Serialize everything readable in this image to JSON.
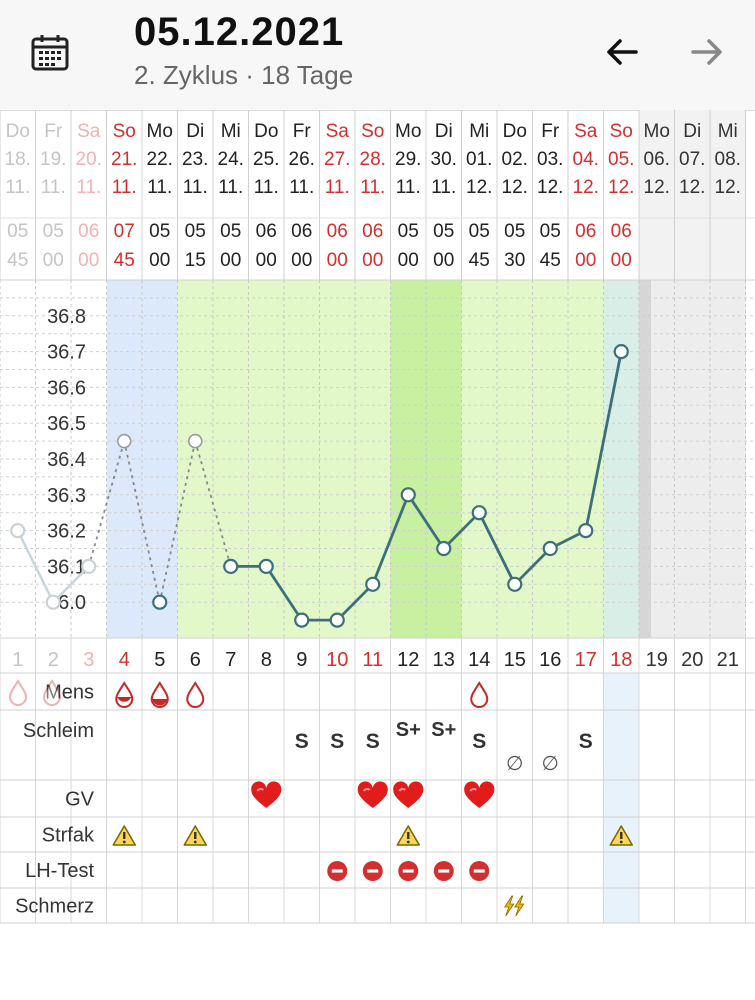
{
  "header": {
    "title": "05.12.2021",
    "subtitle": "2. Zyklus · 18 Tage",
    "icons": {
      "calendar": "calendar-icon",
      "prev": "arrow-left-icon",
      "next": "arrow-right-icon"
    }
  },
  "days": [
    {
      "wd": "Do",
      "d": "18.",
      "m": "11.",
      "h": "05",
      "mi": "45",
      "cd": "1"
    },
    {
      "wd": "Fr",
      "d": "19.",
      "m": "11.",
      "h": "05",
      "mi": "00",
      "cd": "2"
    },
    {
      "wd": "Sa",
      "d": "20.",
      "m": "11.",
      "h": "06",
      "mi": "00",
      "cd": "3"
    },
    {
      "wd": "So",
      "d": "21.",
      "m": "11.",
      "h": "07",
      "mi": "45",
      "cd": "4"
    },
    {
      "wd": "Mo",
      "d": "22.",
      "m": "11.",
      "h": "05",
      "mi": "00",
      "cd": "5"
    },
    {
      "wd": "Di",
      "d": "23.",
      "m": "11.",
      "h": "05",
      "mi": "15",
      "cd": "6"
    },
    {
      "wd": "Mi",
      "d": "24.",
      "m": "11.",
      "h": "05",
      "mi": "00",
      "cd": "7"
    },
    {
      "wd": "Do",
      "d": "25.",
      "m": "11.",
      "h": "06",
      "mi": "00",
      "cd": "8"
    },
    {
      "wd": "Fr",
      "d": "26.",
      "m": "11.",
      "h": "06",
      "mi": "00",
      "cd": "9"
    },
    {
      "wd": "Sa",
      "d": "27.",
      "m": "11.",
      "h": "06",
      "mi": "00",
      "cd": "10"
    },
    {
      "wd": "So",
      "d": "28.",
      "m": "11.",
      "h": "06",
      "mi": "00",
      "cd": "11"
    },
    {
      "wd": "Mo",
      "d": "29.",
      "m": "11.",
      "h": "05",
      "mi": "00",
      "cd": "12"
    },
    {
      "wd": "Di",
      "d": "30.",
      "m": "11.",
      "h": "05",
      "mi": "00",
      "cd": "13"
    },
    {
      "wd": "Mi",
      "d": "01.",
      "m": "12.",
      "h": "05",
      "mi": "45",
      "cd": "14"
    },
    {
      "wd": "Do",
      "d": "02.",
      "m": "12.",
      "h": "05",
      "mi": "30",
      "cd": "15"
    },
    {
      "wd": "Fr",
      "d": "03.",
      "m": "12.",
      "h": "05",
      "mi": "45",
      "cd": "16"
    },
    {
      "wd": "Sa",
      "d": "04.",
      "m": "12.",
      "h": "06",
      "mi": "00",
      "cd": "17"
    },
    {
      "wd": "So",
      "d": "05.",
      "m": "12.",
      "h": "06",
      "mi": "00",
      "cd": "18"
    },
    {
      "wd": "Mo",
      "d": "06.",
      "m": "12.",
      "h": "",
      "mi": "",
      "cd": "19"
    },
    {
      "wd": "Di",
      "d": "07.",
      "m": "12.",
      "h": "",
      "mi": "",
      "cd": "20"
    },
    {
      "wd": "Mi",
      "d": "08.",
      "m": "12.",
      "h": "",
      "mi": "",
      "cd": "21"
    }
  ],
  "chart_data": {
    "type": "line",
    "ylim": [
      35.9,
      36.9
    ],
    "y_ticks": [
      "36.8",
      "36.7",
      "36.6",
      "36.5",
      "36.4",
      "36.3",
      "36.2",
      "36.1",
      "36.0"
    ],
    "x_cycle_days": [
      1,
      2,
      3,
      4,
      5,
      6,
      7,
      8,
      9,
      10,
      11,
      12,
      13,
      14,
      15,
      16,
      17,
      18,
      19,
      20,
      21
    ],
    "temperatures": [
      36.2,
      36.0,
      36.1,
      36.45,
      36.0,
      36.45,
      36.1,
      36.1,
      35.95,
      35.95,
      36.05,
      36.3,
      36.15,
      36.25,
      36.05,
      36.15,
      36.2,
      36.7,
      null,
      null,
      null
    ],
    "excluded_days": [
      4,
      6
    ],
    "phases": {
      "menstruation_days": [
        4,
        5
      ],
      "fertile_days": [
        6,
        17
      ],
      "peak_days": [
        12,
        13
      ],
      "today": 18
    },
    "colors": {
      "line": "#3d6f7a",
      "menstruation": "#dbe9fb",
      "fertile": "#e2f8c9",
      "peak": "#c7f0a1",
      "future": "#ededed",
      "weekend": "#d32f2f"
    }
  },
  "symptoms": {
    "labels": {
      "mens": "Mens",
      "schleim": "Schleim",
      "gv": "GV",
      "strfak": "Strfak",
      "lh": "LH-Test",
      "schmerz": "Schmerz"
    },
    "mens": [
      {
        "day": 4,
        "level": "heavy"
      },
      {
        "day": 5,
        "level": "medium"
      },
      {
        "day": 6,
        "level": "light"
      },
      {
        "day": 14,
        "level": "light"
      }
    ],
    "schleim": [
      {
        "day": 9,
        "value": "S",
        "pos": "bottom"
      },
      {
        "day": 10,
        "value": "S",
        "pos": "bottom"
      },
      {
        "day": 11,
        "value": "S",
        "pos": "bottom"
      },
      {
        "day": 12,
        "value": "S+",
        "pos": "top"
      },
      {
        "day": 13,
        "value": "S+",
        "pos": "top"
      },
      {
        "day": 14,
        "value": "S",
        "pos": "bottom"
      },
      {
        "day": 15,
        "value": "∅",
        "pos": "low"
      },
      {
        "day": 16,
        "value": "∅",
        "pos": "low"
      },
      {
        "day": 17,
        "value": "S",
        "pos": "bottom"
      }
    ],
    "gv": [
      8,
      11,
      12,
      14
    ],
    "strfak": [
      4,
      6,
      12,
      18
    ],
    "lh": [
      10,
      11,
      12,
      13,
      14
    ],
    "schmerz": [
      15
    ]
  }
}
